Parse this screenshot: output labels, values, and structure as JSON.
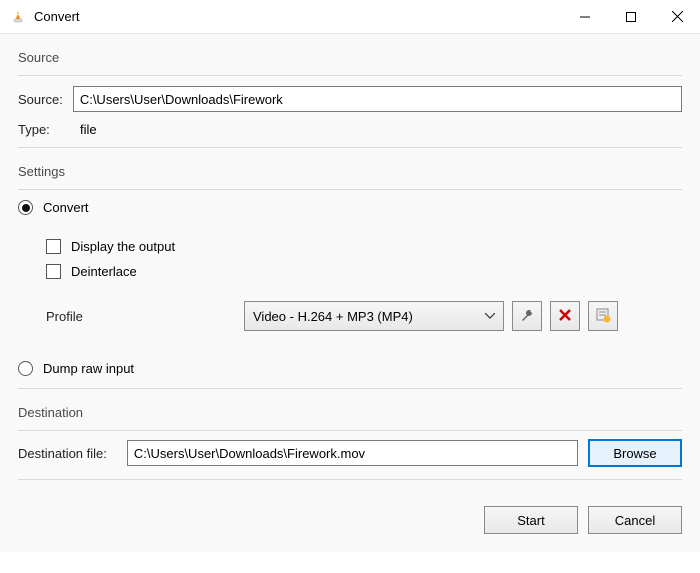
{
  "window": {
    "title": "Convert"
  },
  "source": {
    "legend": "Source",
    "label": "Source:",
    "value": "C:\\Users\\User\\Downloads\\Firework",
    "type_label": "Type:",
    "type_value": "file"
  },
  "settings": {
    "legend": "Settings",
    "convert_label": "Convert",
    "display_output_label": "Display the output",
    "deinterlace_label": "Deinterlace",
    "profile_label": "Profile",
    "profile_value": "Video - H.264 + MP3 (MP4)",
    "dump_label": "Dump raw input"
  },
  "destination": {
    "legend": "Destination",
    "label": "Destination file:",
    "value": "C:\\Users\\User\\Downloads\\Firework.mov",
    "browse_label": "Browse"
  },
  "footer": {
    "start_label": "Start",
    "cancel_label": "Cancel"
  }
}
